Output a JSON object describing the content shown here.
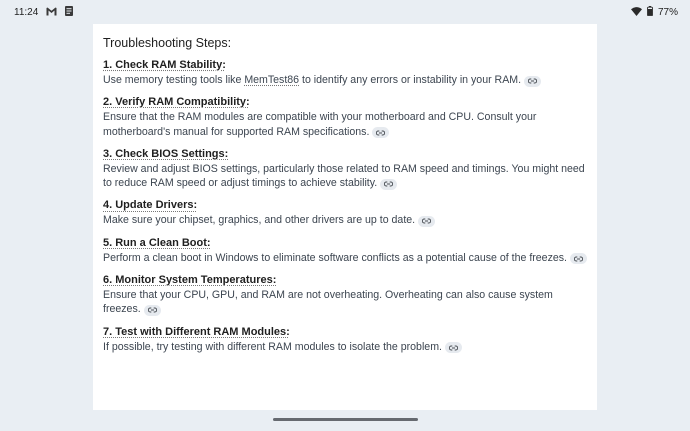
{
  "status": {
    "time": "11:24",
    "battery": "77%",
    "icons": [
      "gmail-icon",
      "notes-icon",
      "wifi-icon",
      "battery-icon"
    ]
  },
  "doc": {
    "title": "Troubleshooting Steps:",
    "steps": [
      {
        "title": "1. Check RAM Stability:",
        "body_pre": "Use memory testing tools like ",
        "body_link": "MemTest86",
        "body_post": " to identify any errors or instability in your RAM."
      },
      {
        "title": "2. Verify RAM Compatibility:",
        "body": "Ensure that the RAM modules are compatible with your motherboard and CPU. Consult your motherboard's manual for supported RAM specifications."
      },
      {
        "title": "3. Check BIOS Settings:",
        "body": "Review and adjust BIOS settings, particularly those related to RAM speed and timings. You might need to reduce RAM speed or adjust timings to achieve stability."
      },
      {
        "title": "4. Update Drivers:",
        "body": "Make sure your chipset, graphics, and other drivers are up to date."
      },
      {
        "title": "5. Run a Clean Boot:",
        "body": "Perform a clean boot in Windows to eliminate software conflicts as a potential cause of the freezes."
      },
      {
        "title": "6. Monitor System Temperatures:",
        "body": "Ensure that your CPU, GPU, and RAM are not overheating. Overheating can also cause system freezes."
      },
      {
        "title": "7. Test with Different RAM Modules:",
        "body": "If possible, try testing with different RAM modules to isolate the problem."
      }
    ]
  }
}
